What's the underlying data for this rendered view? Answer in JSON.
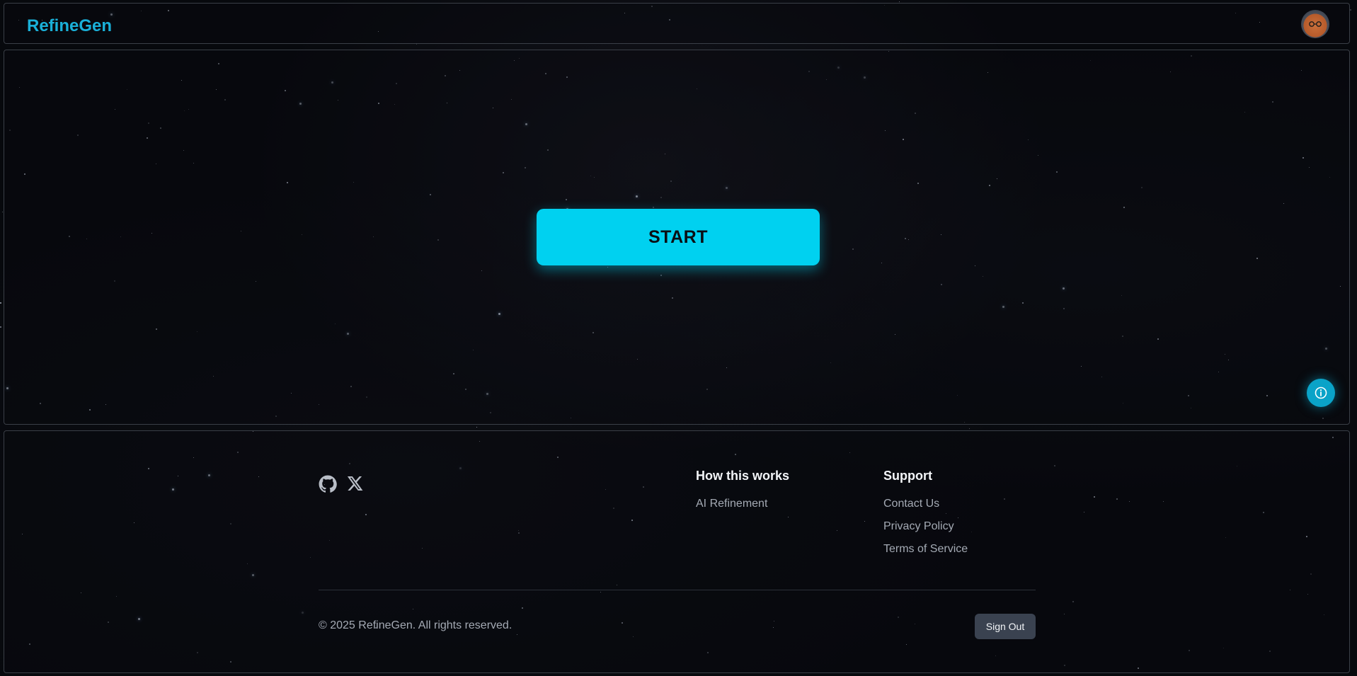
{
  "header": {
    "brand": "RefineGen",
    "avatar_icon": "avatar-icon"
  },
  "main": {
    "start_label": "START",
    "info_icon": "info-icon"
  },
  "footer": {
    "social": [
      "github-icon",
      "x-icon"
    ],
    "how_title": "How this works",
    "how_links": [
      "AI Refinement"
    ],
    "support_title": "Support",
    "support_links": [
      "Contact Us",
      "Privacy Policy",
      "Terms of Service"
    ],
    "copyright": "© 2025 RefineGen. All rights reserved.",
    "signout_label": "Sign Out"
  },
  "colors": {
    "accent": "#00d1f0",
    "brand": "#1ab0d8",
    "background": "#07090d"
  }
}
